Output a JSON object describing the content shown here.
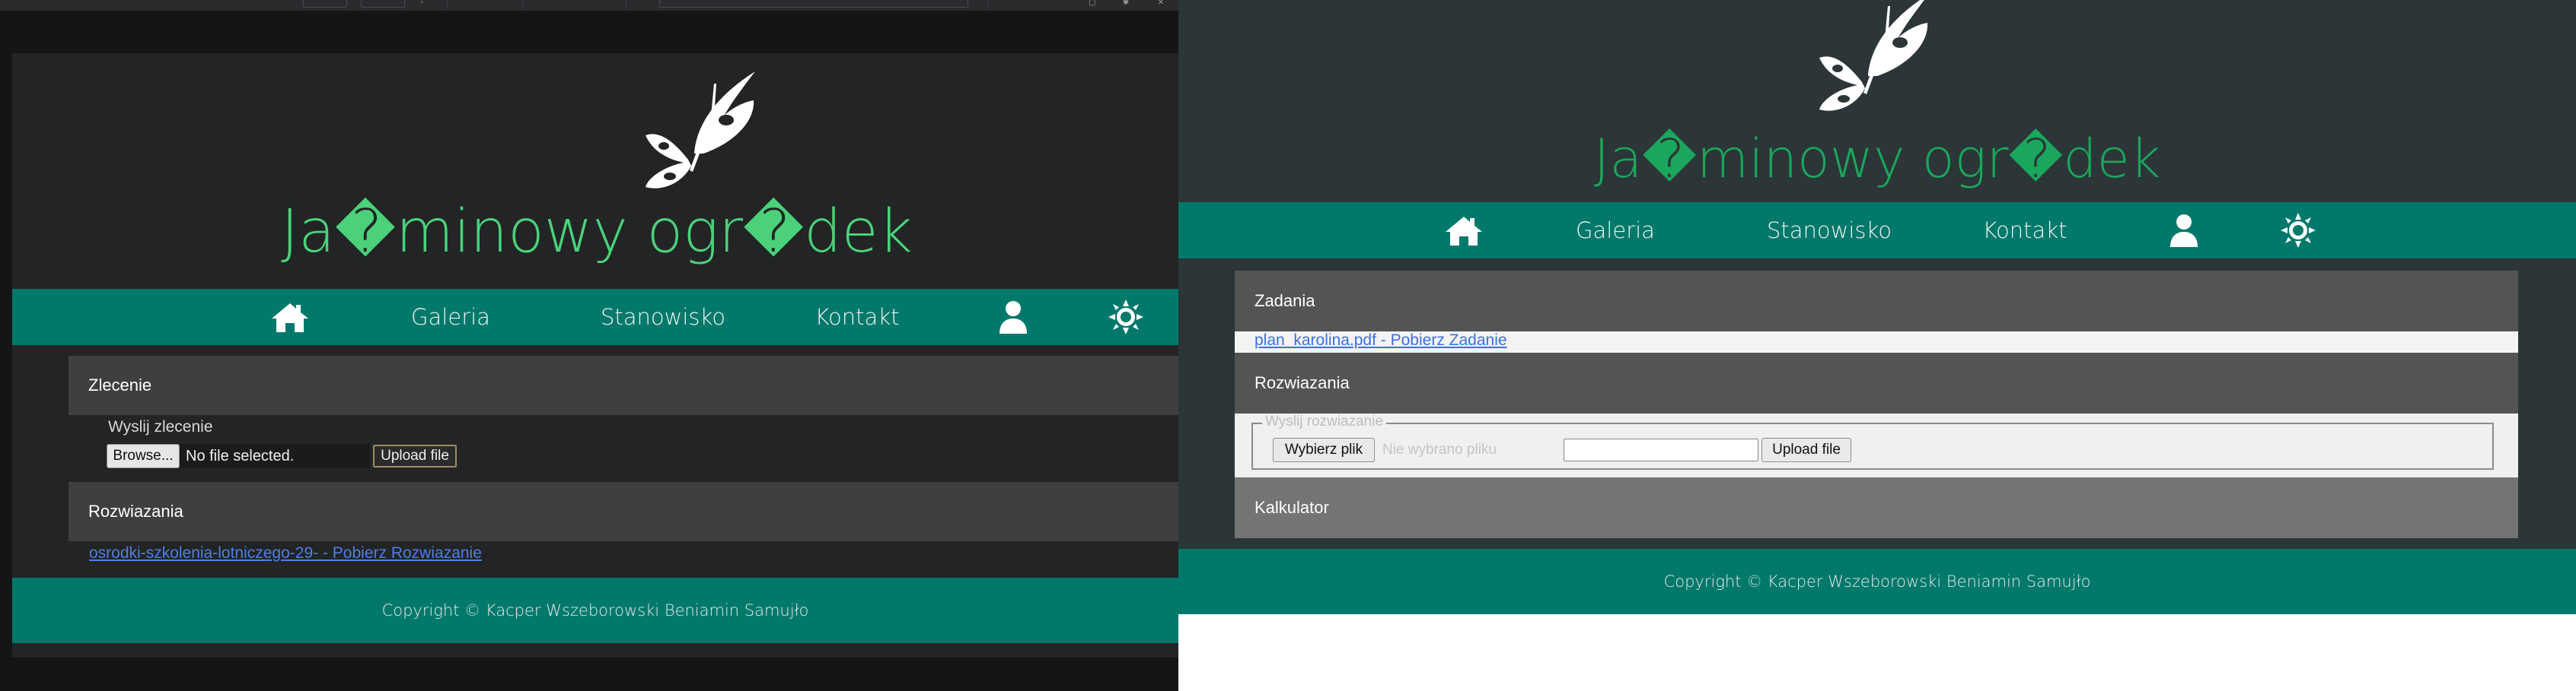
{
  "site": {
    "title": "Ja�minowy ogr�dek",
    "footer": "Copyright © Kacper Wszeborowski Beniamin Samujło"
  },
  "nav": {
    "items": [
      "Galeria",
      "Stanowisko",
      "Kontakt"
    ],
    "icons": [
      "home-icon",
      "user-icon",
      "sun-icon"
    ]
  },
  "left": {
    "zlecenie": {
      "heading": "Zlecenie",
      "legend": "Wyslij zlecenie",
      "browse": "Browse...",
      "file_status": "No file selected.",
      "upload": "Upload file"
    },
    "rozwiazania": {
      "heading": "Rozwiazania",
      "link": "osrodki-szkolenia-lotniczego-29- - Pobierz Rozwiazanie"
    }
  },
  "right": {
    "zadania": {
      "heading": "Zadania",
      "link": "plan_karolina.pdf - Pobierz Zadanie"
    },
    "rozwiazania": {
      "heading": "Rozwiazania",
      "legend": "Wyslij rozwiazanie",
      "choose": "Wybierz plik",
      "file_status": "Nie wybrano pliku",
      "upload": "Upload file"
    },
    "kalkulator": {
      "heading": "Kalkulator"
    }
  },
  "colors": {
    "accent_green": "#1aa65c",
    "left_title_green": "#4ad17a",
    "nav_teal": "#00796b",
    "link_blue": "#3d6fe0"
  }
}
